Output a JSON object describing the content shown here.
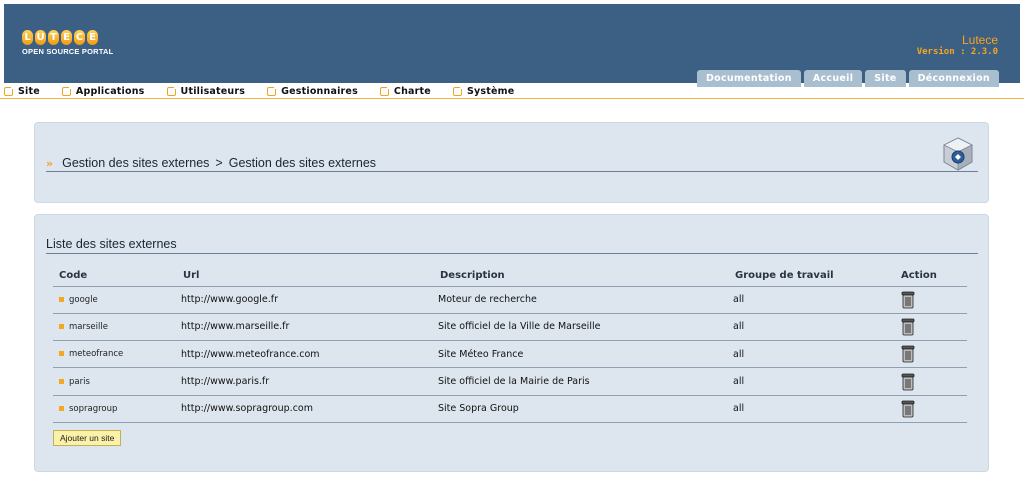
{
  "header": {
    "logo_letters": [
      "L",
      "U",
      "T",
      "E",
      "C",
      "E"
    ],
    "logo_subtitle": "OPEN SOURCE PORTAL",
    "app_name": "Lutece",
    "version": "Version : 2.3.0",
    "tabs": [
      {
        "label": "Documentation"
      },
      {
        "label": "Accueil"
      },
      {
        "label": "Site"
      },
      {
        "label": "Déconnexion"
      }
    ]
  },
  "menu": {
    "items": [
      {
        "label": "Site"
      },
      {
        "label": "Applications"
      },
      {
        "label": "Utilisateurs"
      },
      {
        "label": "Gestionnaires"
      },
      {
        "label": "Charte"
      },
      {
        "label": "Système"
      }
    ]
  },
  "breadcrumb": {
    "part1": "Gestion des sites externes",
    "separator": ">",
    "part2": "Gestion des sites externes"
  },
  "list": {
    "title": "Liste des sites externes",
    "columns": {
      "code": "Code",
      "url": "Url",
      "description": "Description",
      "group": "Groupe de travail",
      "action": "Action"
    },
    "rows": [
      {
        "code": "google",
        "url": "http://www.google.fr",
        "description": "Moteur de recherche",
        "group": "all"
      },
      {
        "code": "marseille",
        "url": "http://www.marseille.fr",
        "description": "Site officiel de la Ville de Marseille",
        "group": "all"
      },
      {
        "code": "meteofrance",
        "url": "http://www.meteofrance.com",
        "description": "Site Méteo France",
        "group": "all"
      },
      {
        "code": "paris",
        "url": "http://www.paris.fr",
        "description": "Site officiel de la Mairie de Paris",
        "group": "all"
      },
      {
        "code": "sopragroup",
        "url": "http://www.sopragroup.com",
        "description": "Site Sopra Group",
        "group": "all"
      }
    ],
    "add_button": "Ajouter un site"
  },
  "colors": {
    "header_bg": "#3c5f84",
    "accent": "#f5a623",
    "tab_bg": "#a9bfcf",
    "panel_bg": "#dde6ef"
  }
}
